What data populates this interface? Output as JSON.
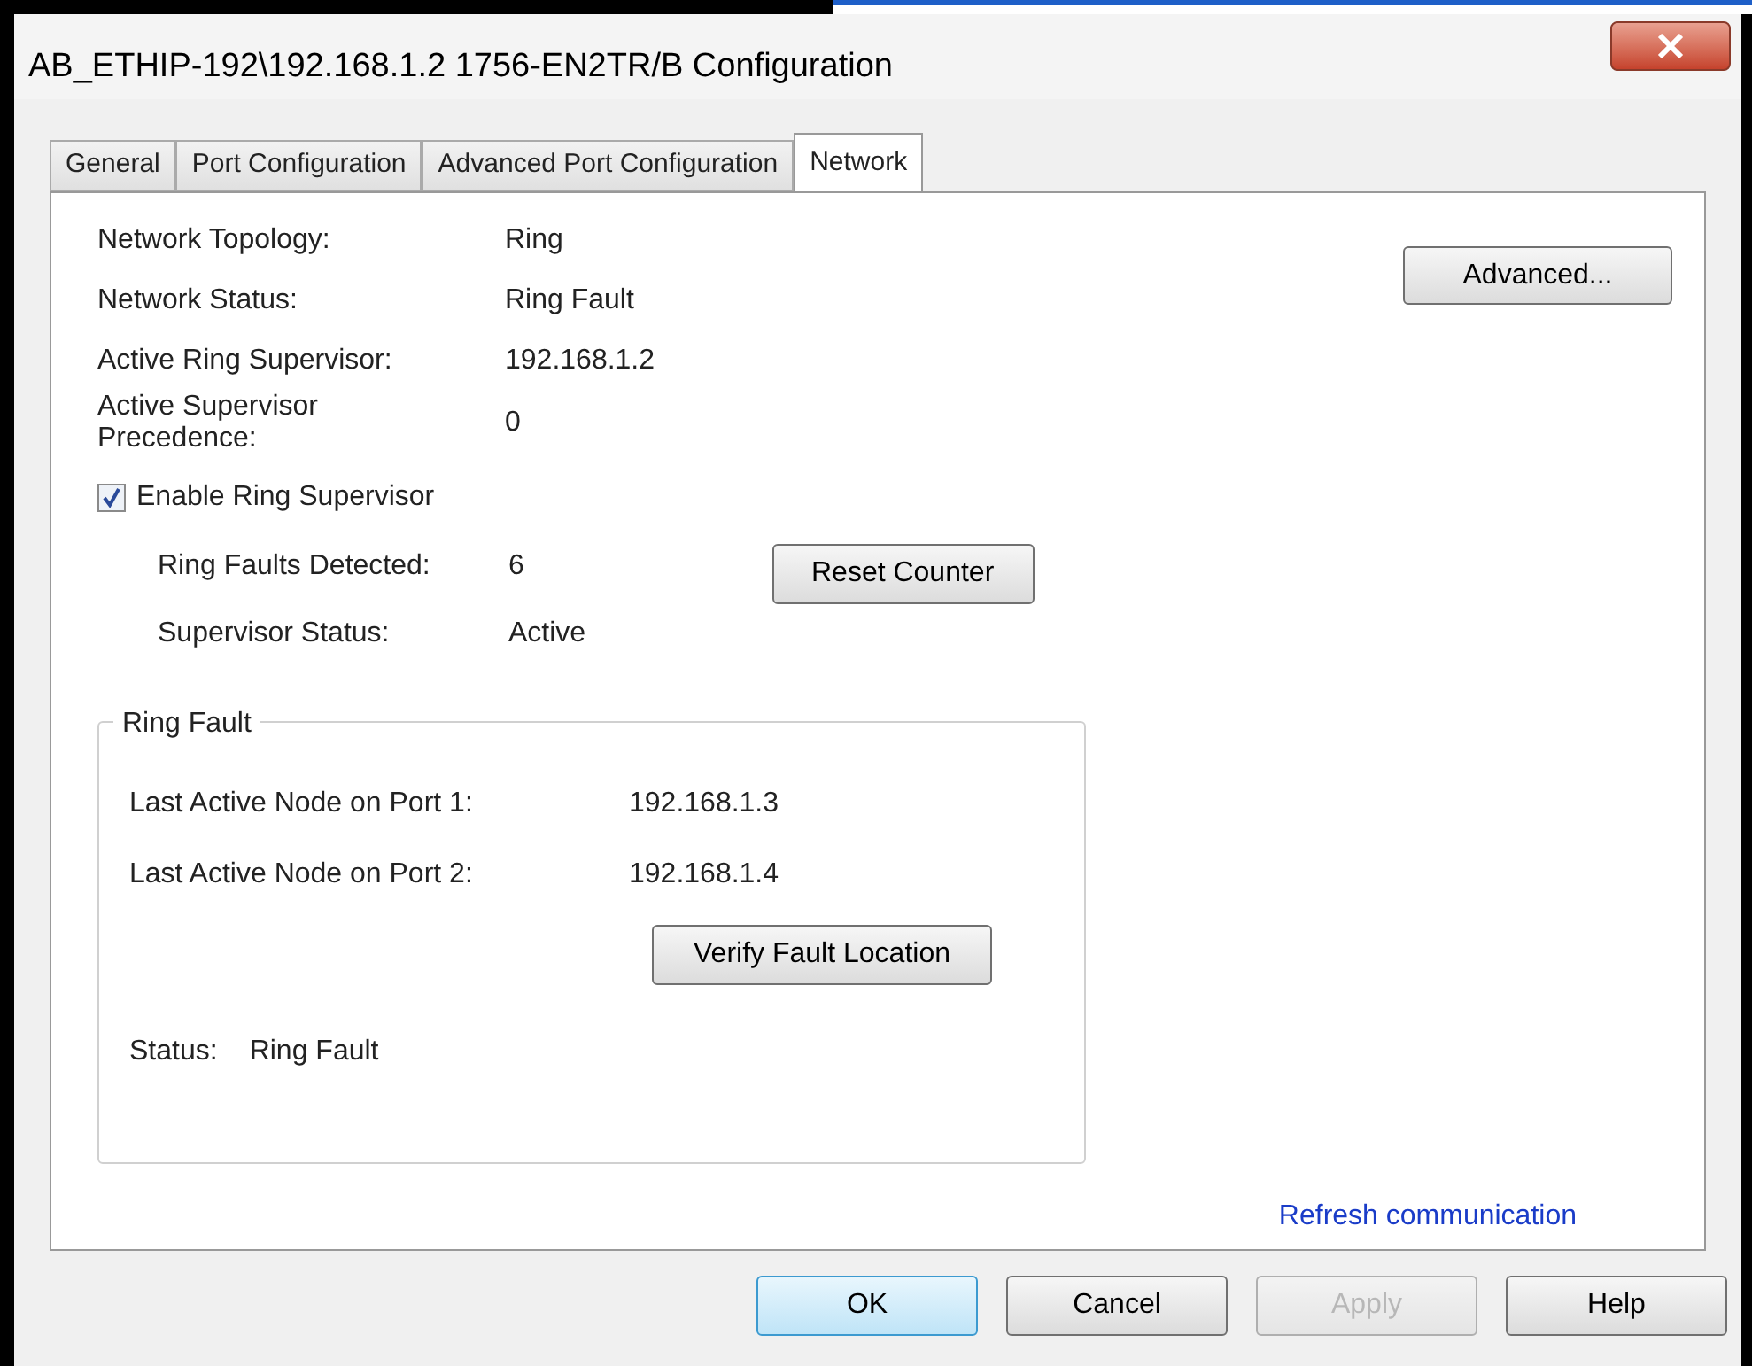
{
  "window": {
    "title": "AB_ETHIP-192\\192.168.1.2 1756-EN2TR/B Configuration"
  },
  "tabs": [
    {
      "label": "General",
      "selected": false
    },
    {
      "label": "Port Configuration",
      "selected": false
    },
    {
      "label": "Advanced Port Configuration",
      "selected": false
    },
    {
      "label": "Network",
      "selected": true
    }
  ],
  "info": [
    {
      "label": "Network Topology:",
      "value": "Ring"
    },
    {
      "label": "Network Status:",
      "value": "Ring Fault"
    },
    {
      "label": "Active Ring Supervisor:",
      "value": "192.168.1.2"
    },
    {
      "label": "Active Supervisor Precedence:",
      "value": "0"
    }
  ],
  "advanced_button": "Advanced...",
  "enable_supervisor": {
    "label": "Enable Ring Supervisor",
    "checked": true
  },
  "supervisor": [
    {
      "label": "Ring Faults Detected:",
      "value": "6"
    },
    {
      "label": "Supervisor Status:",
      "value": "Active"
    }
  ],
  "reset_button": "Reset Counter",
  "ring_fault": {
    "title": "Ring Fault",
    "rows": [
      {
        "label": "Last Active Node on Port 1:",
        "value": "192.168.1.3"
      },
      {
        "label": "Last Active Node on Port 2:",
        "value": "192.168.1.4"
      }
    ],
    "verify_button": "Verify Fault Location",
    "status_label": "Status:",
    "status_value": "Ring Fault"
  },
  "refresh_link": "Refresh communication",
  "buttons": [
    {
      "label": "OK",
      "kind": "default",
      "disabled": false
    },
    {
      "label": "Cancel",
      "kind": "normal",
      "disabled": false
    },
    {
      "label": "Apply",
      "kind": "normal",
      "disabled": true
    },
    {
      "label": "Help",
      "kind": "normal",
      "disabled": false
    }
  ]
}
